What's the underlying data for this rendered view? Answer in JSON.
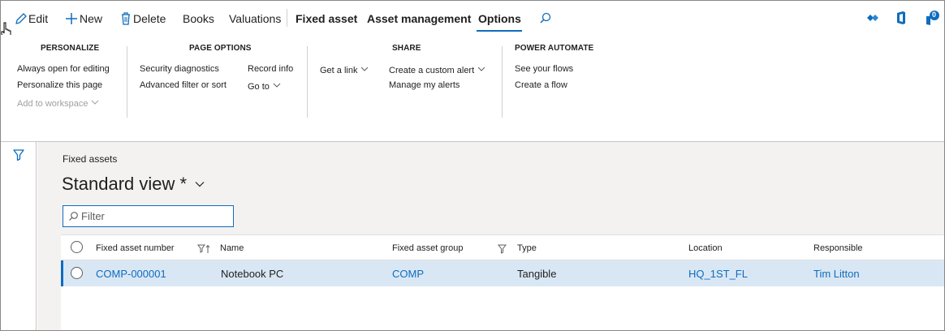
{
  "action_pane": {
    "edit": "Edit",
    "new": "New",
    "delete": "Delete",
    "books": "Books",
    "valuations": "Valuations",
    "fixed_asset": "Fixed asset",
    "asset_management": "Asset management",
    "options": "Options",
    "notification_count": "0"
  },
  "ribbon": {
    "personalize": {
      "title": "PERSONALIZE",
      "always_open": "Always open for editing",
      "personalize_page": "Personalize this page",
      "add_to_workspace": "Add to workspace"
    },
    "page_options": {
      "title": "PAGE OPTIONS",
      "security_diagnostics": "Security diagnostics",
      "advanced_filter": "Advanced filter or sort",
      "record_info": "Record info",
      "go_to": "Go to"
    },
    "share": {
      "title": "SHARE",
      "get_link": "Get a link",
      "custom_alert": "Create a custom alert",
      "manage_alerts": "Manage my alerts"
    },
    "power_automate": {
      "title": "POWER AUTOMATE",
      "see_flows": "See your flows",
      "create_flow": "Create a flow"
    }
  },
  "page": {
    "breadcrumb": "Fixed assets",
    "view_title": "Standard view *",
    "filter_placeholder": "Filter"
  },
  "grid": {
    "columns": [
      "Fixed asset number",
      "Name",
      "Fixed asset group",
      "Type",
      "Location",
      "Responsible"
    ],
    "rows": [
      {
        "number": "COMP-000001",
        "name": "Notebook PC",
        "group": "COMP",
        "type": "Tangible",
        "location": "HQ_1ST_FL",
        "responsible": "Tim Litton"
      }
    ]
  },
  "colors": {
    "accent": "#0f6cbd",
    "selected_row": "#d9e7f5",
    "content_bg": "#f3f2f1"
  }
}
